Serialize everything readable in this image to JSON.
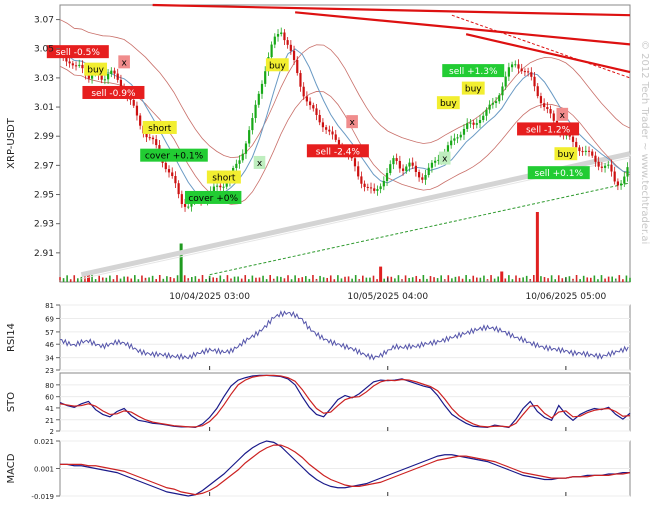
{
  "watermark": "© 2012 Tech Trader ~ www.techtrader.ai",
  "chart_data": [
    {
      "panel": "price",
      "type": "candlestick",
      "ylabel": "XRP-USDT",
      "ylim": [
        2.89,
        3.08
      ],
      "yticks": [
        "3.07",
        "3.05",
        "3.03",
        "3.01",
        "2.99",
        "2.97",
        "2.95",
        "2.93",
        "2.91"
      ],
      "ytick_values": [
        3.07,
        3.05,
        3.03,
        3.01,
        2.99,
        2.97,
        2.95,
        2.93,
        2.91
      ],
      "xlabels": [
        "10/04/2025 03:00",
        "10/05/2025 04:00",
        "10/06/2025 05:00"
      ],
      "x_range_hours": [
        0,
        80
      ],
      "xlabel_hours": [
        21,
        46,
        71
      ],
      "close_path": [
        [
          0,
          3.048
        ],
        [
          1,
          3.043
        ],
        [
          2,
          3.035
        ],
        [
          3,
          3.04
        ],
        [
          4,
          3.03
        ],
        [
          5,
          3.032
        ],
        [
          6,
          3.03
        ],
        [
          7,
          3.035
        ],
        [
          8,
          3.028
        ],
        [
          9,
          3.022
        ],
        [
          10,
          3.013
        ],
        [
          11,
          3.0
        ],
        [
          12,
          2.992
        ],
        [
          13,
          2.986
        ],
        [
          14,
          2.978
        ],
        [
          15,
          2.968
        ],
        [
          16,
          2.958
        ],
        [
          17,
          2.946
        ],
        [
          18,
          2.942
        ],
        [
          19,
          2.945
        ],
        [
          20,
          2.948
        ],
        [
          21,
          2.95
        ],
        [
          22,
          2.955
        ],
        [
          23,
          2.958
        ],
        [
          24,
          2.963
        ],
        [
          25,
          2.972
        ],
        [
          26,
          2.985
        ],
        [
          27,
          3.0
        ],
        [
          28,
          3.022
        ],
        [
          29,
          3.04
        ],
        [
          30,
          3.055
        ],
        [
          31,
          3.064
        ],
        [
          32,
          3.052
        ],
        [
          33,
          3.038
        ],
        [
          34,
          3.022
        ],
        [
          35,
          3.01
        ],
        [
          36,
          3.004
        ],
        [
          37,
          2.998
        ],
        [
          38,
          2.99
        ],
        [
          39,
          2.985
        ],
        [
          40,
          2.98
        ],
        [
          41,
          2.972
        ],
        [
          42,
          2.962
        ],
        [
          43,
          2.955
        ],
        [
          44,
          2.95
        ],
        [
          45,
          2.958
        ],
        [
          46,
          2.965
        ],
        [
          47,
          2.975
        ],
        [
          48,
          2.968
        ],
        [
          49,
          2.97
        ],
        [
          50,
          2.965
        ],
        [
          51,
          2.962
        ],
        [
          52,
          2.968
        ],
        [
          53,
          2.975
        ],
        [
          54,
          2.98
        ],
        [
          55,
          2.985
        ],
        [
          56,
          2.992
        ],
        [
          57,
          2.998
        ],
        [
          58,
          2.996
        ],
        [
          59,
          3.004
        ],
        [
          60,
          3.008
        ],
        [
          61,
          3.012
        ],
        [
          62,
          3.025
        ],
        [
          63,
          3.035
        ],
        [
          64,
          3.04
        ],
        [
          65,
          3.036
        ],
        [
          66,
          3.03
        ],
        [
          67,
          3.02
        ],
        [
          68,
          3.01
        ],
        [
          69,
          3.002
        ],
        [
          70,
          2.995
        ],
        [
          71,
          2.99
        ],
        [
          72,
          2.985
        ],
        [
          73,
          2.982
        ],
        [
          74,
          2.978
        ],
        [
          75,
          2.974
        ],
        [
          76,
          2.97
        ],
        [
          77,
          2.968
        ],
        [
          78,
          2.958
        ],
        [
          79,
          2.96
        ],
        [
          80,
          2.97
        ]
      ],
      "volume_spikes": [
        [
          17,
          0.55
        ],
        [
          45,
          0.22
        ],
        [
          67,
          1.0
        ],
        [
          62,
          0.15
        ],
        [
          4,
          0.1
        ]
      ],
      "trendlines_red": [
        [
          [
            13,
            3.08
          ],
          [
            80,
            3.073
          ]
        ],
        [
          [
            33,
            3.075
          ],
          [
            80,
            3.053
          ]
        ],
        [
          [
            57,
            3.06
          ],
          [
            80,
            3.034
          ]
        ],
        [
          [
            55,
            3.073
          ],
          [
            80,
            3.03
          ]
        ]
      ],
      "trendline_support": [
        [
          [
            3,
            2.895
          ],
          [
            80,
            2.978
          ]
        ]
      ],
      "trendline_dashed_green": [
        [
          [
            21,
            2.895
          ],
          [
            80,
            2.958
          ]
        ]
      ],
      "signals": [
        {
          "text": "sell -0.5%",
          "t": 2.5,
          "y": 3.048,
          "kind": "sell"
        },
        {
          "text": "x",
          "t": 9,
          "y": 3.041,
          "kind": "exit-sell"
        },
        {
          "text": "buy",
          "t": 5,
          "y": 3.036,
          "kind": "buy"
        },
        {
          "text": "sell -0.9%",
          "t": 7.5,
          "y": 3.02,
          "kind": "sell"
        },
        {
          "text": "short",
          "t": 14,
          "y": 2.996,
          "kind": "short"
        },
        {
          "text": "cover +0.1%",
          "t": 16,
          "y": 2.977,
          "kind": "cover"
        },
        {
          "text": "x",
          "t": 28,
          "y": 2.972,
          "kind": "exit-buy"
        },
        {
          "text": "short",
          "t": 23,
          "y": 2.962,
          "kind": "short"
        },
        {
          "text": "cover +0%",
          "t": 21.5,
          "y": 2.948,
          "kind": "cover"
        },
        {
          "text": "buy",
          "t": 30.5,
          "y": 3.039,
          "kind": "buy"
        },
        {
          "text": "x",
          "t": 41,
          "y": 3.0,
          "kind": "exit-sell"
        },
        {
          "text": "sell -2.4%",
          "t": 39,
          "y": 2.98,
          "kind": "sell"
        },
        {
          "text": "x",
          "t": 54,
          "y": 2.975,
          "kind": "exit-buy"
        },
        {
          "text": "buy",
          "t": 54.5,
          "y": 3.013,
          "kind": "buy"
        },
        {
          "text": "buy",
          "t": 58,
          "y": 3.023,
          "kind": "buy"
        },
        {
          "text": "sell +1.3%",
          "t": 58,
          "y": 3.035,
          "kind": "sell-win"
        },
        {
          "text": "sell -1.2%",
          "t": 68.5,
          "y": 2.995,
          "kind": "sell"
        },
        {
          "text": "x",
          "t": 70.5,
          "y": 3.005,
          "kind": "exit-sell"
        },
        {
          "text": "buy",
          "t": 71,
          "y": 2.978,
          "kind": "buy"
        },
        {
          "text": "sell +0.1%",
          "t": 70,
          "y": 2.965,
          "kind": "sell-win"
        }
      ]
    },
    {
      "panel": "rsi",
      "type": "line",
      "ylabel": "RSI14",
      "ylim": [
        23,
        81
      ],
      "yticks": [
        "81",
        "69",
        "57",
        "46",
        "34",
        "23"
      ],
      "ytick_values": [
        81,
        69,
        57,
        46,
        34,
        23
      ],
      "series": [
        {
          "values": [
            50,
            47,
            45,
            48,
            49,
            46,
            44,
            46,
            48,
            47,
            44,
            40,
            38,
            37,
            37,
            36,
            35,
            35,
            34,
            37,
            39,
            41,
            40,
            39,
            40,
            44,
            49,
            53,
            57,
            63,
            70,
            73,
            74,
            72,
            68,
            60,
            55,
            51,
            48,
            46,
            44,
            42,
            39,
            36,
            34,
            36,
            40,
            44,
            43,
            44,
            44,
            46,
            47,
            48,
            50,
            52,
            54,
            56,
            58,
            60,
            61,
            60,
            58,
            55,
            52,
            50,
            47,
            45,
            43,
            42,
            41,
            40,
            38,
            38,
            37,
            36,
            35,
            37,
            39,
            41,
            43
          ]
        }
      ]
    },
    {
      "panel": "sto",
      "type": "line",
      "ylabel": "STO",
      "ylim": [
        2,
        100
      ],
      "yticks": [
        "80",
        "60",
        "41",
        "21",
        "2"
      ],
      "ytick_values": [
        80,
        60,
        41,
        21,
        2
      ],
      "series": [
        {
          "values": [
            50,
            45,
            42,
            48,
            52,
            38,
            30,
            26,
            35,
            40,
            28,
            20,
            18,
            15,
            14,
            12,
            10,
            9,
            9,
            8,
            14,
            25,
            40,
            60,
            78,
            88,
            92,
            95,
            96,
            96,
            95,
            94,
            90,
            80,
            60,
            42,
            30,
            26,
            40,
            55,
            62,
            58,
            65,
            75,
            85,
            88,
            87,
            88,
            90,
            86,
            82,
            78,
            75,
            62,
            45,
            30,
            22,
            15,
            10,
            9,
            8,
            12,
            10,
            8,
            22,
            40,
            52,
            35,
            25,
            20,
            45,
            30,
            20,
            30,
            36,
            40,
            38,
            42,
            30,
            22,
            32
          ]
        },
        {
          "values": [
            48,
            46,
            44,
            45,
            48,
            44,
            36,
            30,
            31,
            36,
            34,
            27,
            21,
            17,
            15,
            13,
            11,
            10,
            9,
            9,
            11,
            18,
            30,
            46,
            64,
            80,
            88,
            93,
            95,
            96,
            96,
            95,
            92,
            86,
            72,
            55,
            40,
            32,
            34,
            45,
            55,
            59,
            60,
            68,
            78,
            85,
            88,
            87,
            89,
            88,
            85,
            81,
            77,
            70,
            56,
            40,
            28,
            20,
            14,
            10,
            9,
            10,
            10,
            9,
            15,
            30,
            44,
            45,
            32,
            24,
            34,
            36,
            26,
            27,
            33,
            37,
            39,
            40,
            35,
            27,
            28
          ]
        }
      ]
    },
    {
      "panel": "macd",
      "type": "line",
      "ylabel": "MACD",
      "ylim": [
        -0.019,
        0.021
      ],
      "yticks": [
        "0.021",
        "0.001",
        "-0.019"
      ],
      "ytick_values": [
        0.021,
        0.001,
        -0.019
      ],
      "series": [
        {
          "values": [
            0.004,
            0.004,
            0.003,
            0.003,
            0.002,
            0.001,
            0.0,
            -0.001,
            -0.002,
            -0.004,
            -0.006,
            -0.008,
            -0.01,
            -0.012,
            -0.014,
            -0.016,
            -0.017,
            -0.018,
            -0.019,
            -0.018,
            -0.015,
            -0.011,
            -0.007,
            -0.003,
            0.002,
            0.007,
            0.012,
            0.016,
            0.019,
            0.021,
            0.02,
            0.017,
            0.012,
            0.007,
            0.002,
            -0.003,
            -0.007,
            -0.01,
            -0.012,
            -0.013,
            -0.013,
            -0.012,
            -0.011,
            -0.01,
            -0.008,
            -0.006,
            -0.004,
            -0.002,
            0.0,
            0.002,
            0.004,
            0.006,
            0.008,
            0.01,
            0.011,
            0.011,
            0.01,
            0.009,
            0.008,
            0.007,
            0.006,
            0.004,
            0.002,
            0.0,
            -0.002,
            -0.004,
            -0.005,
            -0.006,
            -0.007,
            -0.007,
            -0.006,
            -0.006,
            -0.005,
            -0.005,
            -0.004,
            -0.004,
            -0.004,
            -0.003,
            -0.003,
            -0.002,
            -0.002
          ]
        },
        {
          "values": [
            0.004,
            0.004,
            0.004,
            0.004,
            0.003,
            0.003,
            0.002,
            0.001,
            0.0,
            -0.001,
            -0.003,
            -0.005,
            -0.007,
            -0.009,
            -0.011,
            -0.013,
            -0.014,
            -0.016,
            -0.017,
            -0.018,
            -0.017,
            -0.015,
            -0.012,
            -0.008,
            -0.004,
            0.0,
            0.005,
            0.009,
            0.013,
            0.016,
            0.018,
            0.018,
            0.016,
            0.013,
            0.009,
            0.004,
            0.0,
            -0.004,
            -0.007,
            -0.009,
            -0.011,
            -0.012,
            -0.012,
            -0.011,
            -0.01,
            -0.009,
            -0.007,
            -0.005,
            -0.003,
            -0.001,
            0.001,
            0.003,
            0.005,
            0.007,
            0.008,
            0.009,
            0.01,
            0.01,
            0.009,
            0.008,
            0.007,
            0.006,
            0.004,
            0.002,
            0.0,
            -0.002,
            -0.003,
            -0.004,
            -0.005,
            -0.006,
            -0.006,
            -0.006,
            -0.005,
            -0.005,
            -0.005,
            -0.004,
            -0.004,
            -0.004,
            -0.003,
            -0.003,
            -0.002
          ]
        }
      ]
    }
  ]
}
